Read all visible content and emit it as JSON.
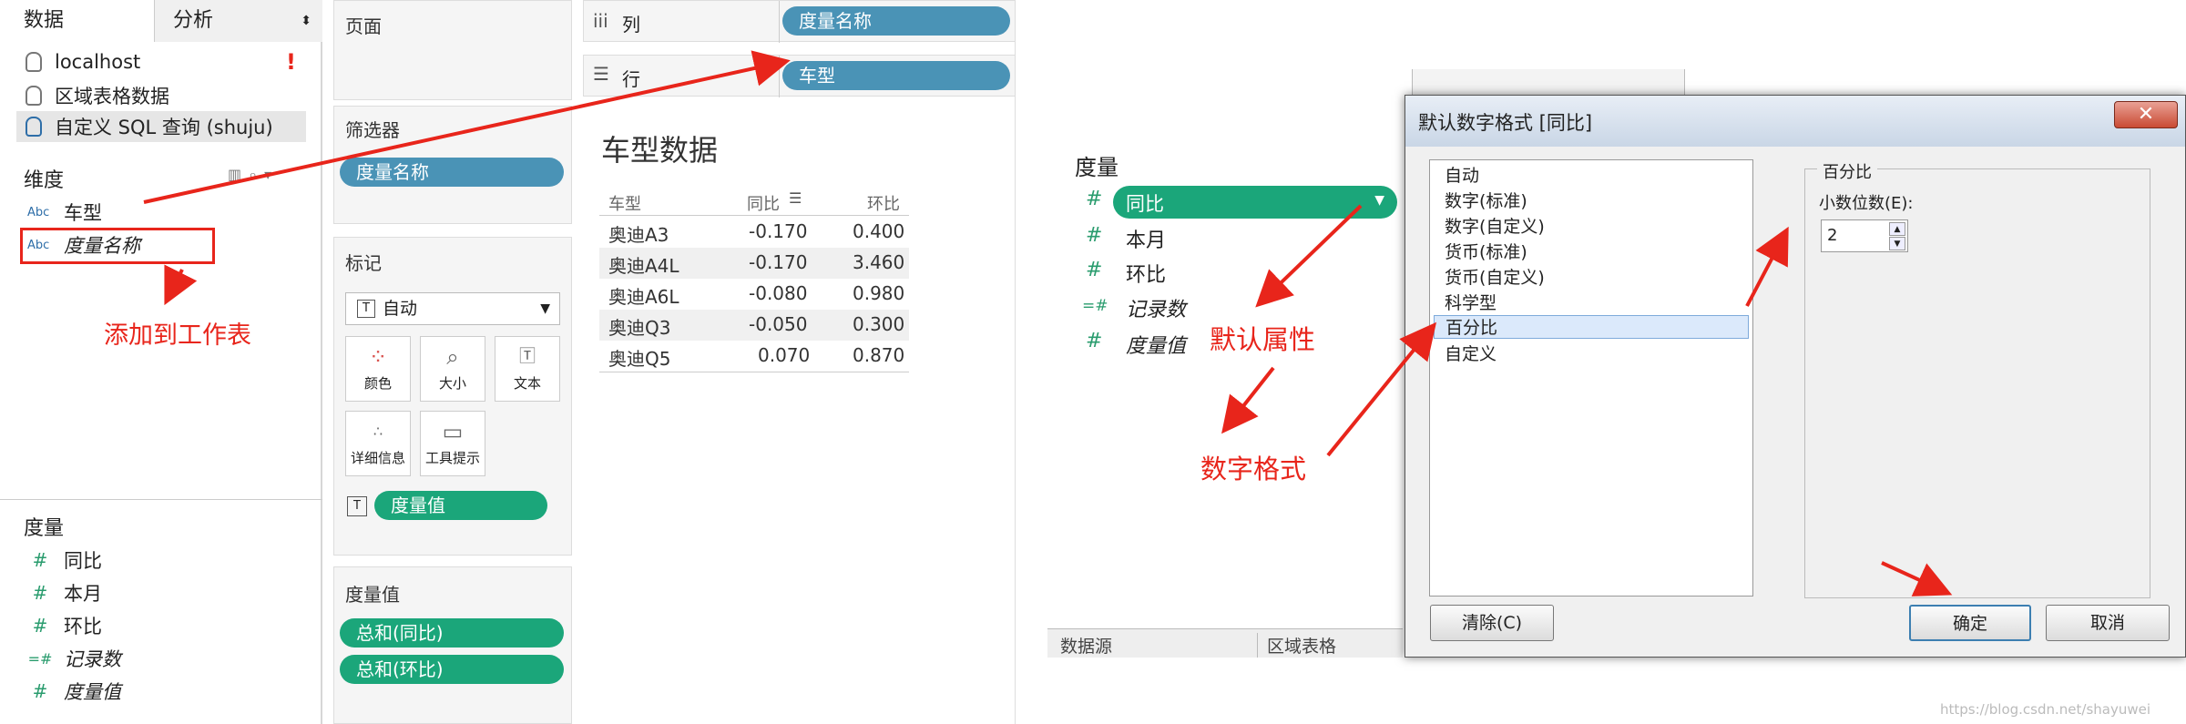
{
  "data_pane": {
    "tab_data": "数据",
    "tab_analysis": "分析",
    "sources": [
      "localhost",
      "区域表格数据",
      "自定义 SQL 查询 (shuju)"
    ],
    "alert": "!",
    "dimensions_header": "维度",
    "dimensions": [
      {
        "type": "Abc",
        "label": "车型"
      },
      {
        "type": "Abc",
        "label": "度量名称"
      }
    ],
    "measures_header": "度量",
    "measures": [
      {
        "icon": "#",
        "label": "同比"
      },
      {
        "icon": "#",
        "label": "本月"
      },
      {
        "icon": "#",
        "label": "环比"
      },
      {
        "icon": "=#",
        "label": "记录数"
      },
      {
        "icon": "#",
        "label": "度量值"
      }
    ]
  },
  "shelves": {
    "pages": "页面",
    "filters": "筛选器",
    "filter_pill": "度量名称",
    "marks": "标记",
    "mark_type": "自动",
    "mark_buttons": [
      "颜色",
      "大小",
      "文本",
      "详细信息",
      "工具提示"
    ],
    "marks_pill": "度量值",
    "measure_values": "度量值",
    "mv_pills": [
      "总和(同比)",
      "总和(环比)"
    ],
    "columns_label": "列",
    "columns_pill": "度量名称",
    "rows_label": "行",
    "rows_pill": "车型"
  },
  "view": {
    "title": "车型数据",
    "headers": [
      "车型",
      "同比",
      "环比"
    ],
    "rows": [
      [
        "奥迪A3",
        "-0.170",
        "0.400"
      ],
      [
        "奥迪A4L",
        "-0.170",
        "3.460"
      ],
      [
        "奥迪A6L",
        "-0.080",
        "0.980"
      ],
      [
        "奥迪Q3",
        "-0.050",
        "0.300"
      ],
      [
        "奥迪Q5",
        "0.070",
        "0.870"
      ]
    ]
  },
  "annotations": {
    "add_to_sheet": "添加到工作表",
    "default_props": "默认属性",
    "number_format": "数字格式"
  },
  "right_pane": {
    "measures_header": "度量",
    "measures": [
      {
        "icon": "#",
        "label": "同比"
      },
      {
        "icon": "#",
        "label": "本月"
      },
      {
        "icon": "#",
        "label": "环比"
      },
      {
        "icon": "=#",
        "label": "记录数"
      },
      {
        "icon": "#",
        "label": "度量值"
      }
    ],
    "bottom_tabs": [
      "数据源",
      "区域表格"
    ]
  },
  "dialog": {
    "title": "默认数字格式 [同比]",
    "formats": [
      "自动",
      "数字(标准)",
      "数字(自定义)",
      "货币(标准)",
      "货币(自定义)",
      "科学型",
      "百分比",
      "自定义"
    ],
    "selected": "百分比",
    "group_title": "百分比",
    "decimals_label": "小数位数(E):",
    "decimals_value": "2",
    "clear": "清除(C)",
    "ok": "确定",
    "cancel": "取消"
  },
  "watermark": "https://blog.csdn.net/shayuwei",
  "colors": {
    "blue_pill": "#4a93b6",
    "green_pill": "#1ba67a",
    "annotation": "#e8251b"
  }
}
